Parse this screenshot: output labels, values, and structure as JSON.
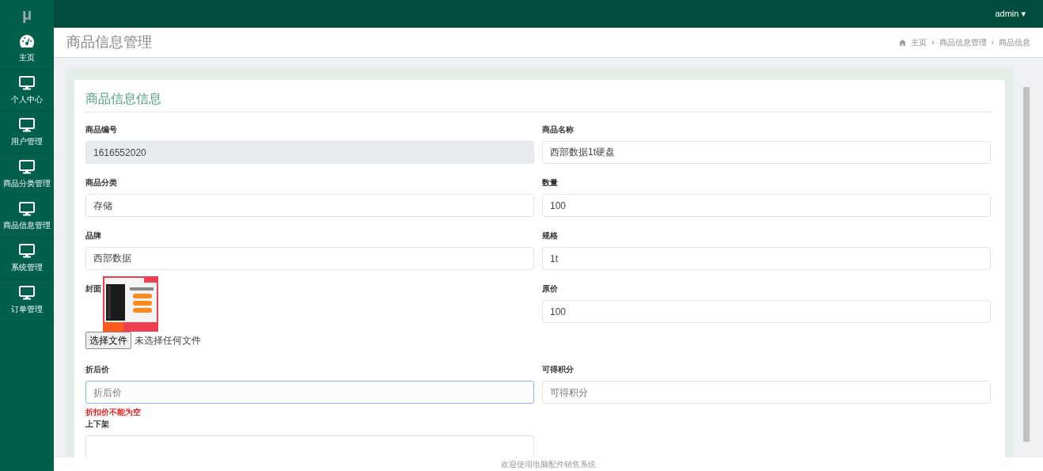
{
  "brand": {
    "logo": "μ"
  },
  "user_menu": {
    "label": "admin",
    "caret": "▾"
  },
  "sidebar": {
    "items": [
      {
        "label": "主页",
        "kind": "dashboard",
        "selected": false
      },
      {
        "label": "个人中心",
        "kind": "monitor",
        "selected": false
      },
      {
        "label": "用户管理",
        "kind": "monitor",
        "selected": false
      },
      {
        "label": "商品分类管理",
        "kind": "monitor",
        "selected": false
      },
      {
        "label": "商品信息管理",
        "kind": "monitor",
        "selected": false
      },
      {
        "label": "系统管理",
        "kind": "monitor",
        "selected": false
      },
      {
        "label": "订单管理",
        "kind": "monitor",
        "selected": false
      }
    ]
  },
  "page_title": "商品信息管理",
  "breadcrumb": [
    {
      "label": "主页",
      "home": true
    },
    {
      "label": "商品信息管理"
    },
    {
      "label": "商品信息"
    }
  ],
  "breadcrumb_separator": "›",
  "form": {
    "title": "商品信息信息",
    "fields": [
      {
        "kind": "text",
        "label": "商品编号",
        "value": "1616552020",
        "disabled": true
      },
      {
        "kind": "text",
        "label": "商品名称",
        "value": "西部数据1t硬盘"
      },
      {
        "kind": "select",
        "label": "商品分类",
        "value": "存储"
      },
      {
        "kind": "text",
        "label": "数量",
        "value": "100"
      },
      {
        "kind": "text",
        "label": "品牌",
        "value": "西部数据"
      },
      {
        "kind": "text",
        "label": "规格",
        "value": "1t"
      },
      {
        "label": "封面",
        "button": "选择文件",
        "status": "未选择任何文件"
      },
      {
        "kind": "text",
        "label": "原价",
        "value": "100"
      },
      {
        "kind": "number",
        "label": "折后价",
        "placeholder": "折后价",
        "focused": true,
        "error": "折扣价不能为空"
      },
      {
        "kind": "text",
        "label": "可得积分",
        "placeholder": "可得积分"
      },
      {
        "kind": "text",
        "label": "上下架"
      }
    ]
  },
  "footer": "欢迎使用电脑配件销售系统"
}
